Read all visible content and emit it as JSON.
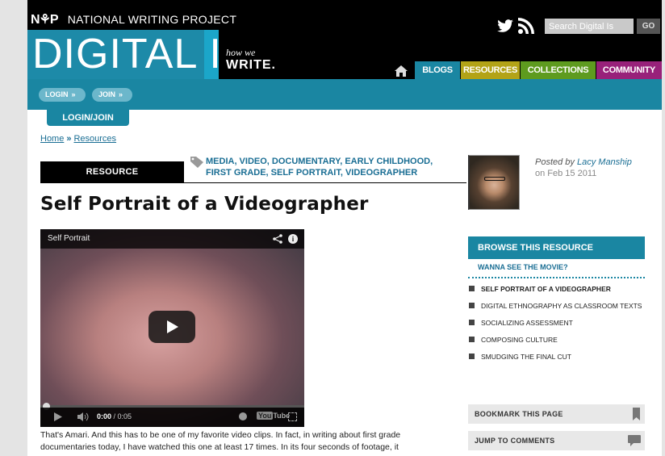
{
  "header": {
    "org_logo": "N⚘P",
    "org_name": "NATIONAL WRITING PROJECT",
    "brand_digital": "DIGITAL",
    "brand_is": "IS",
    "tagline_small": "how we",
    "tagline_big": "WRITE.",
    "search_placeholder": "Search Digital Is",
    "go_label": "GO",
    "nav": {
      "blogs": "BLOGS",
      "resources": "RESOURCES",
      "collections": "COLLECTIONS",
      "community": "COMMUNITY"
    },
    "colors": {
      "blogs": "#1a86a2",
      "resources": "#b3a317",
      "collections": "#5e9b1f",
      "community": "#98217a"
    }
  },
  "account": {
    "login_label": "LOGIN",
    "join_label": "JOIN",
    "arrow": "»",
    "tab_label": "LOGIN/JOIN"
  },
  "breadcrumb": {
    "home": "Home",
    "separator": "»",
    "current": "Resources"
  },
  "resource": {
    "type_label": "RESOURCE",
    "tags_line1": "MEDIA, VIDEO, DOCUMENTARY, EARLY CHILDHOOD,",
    "tags_line2": "FIRST GRADE, SELF PORTRAIT, VIDEOGRAPHER",
    "title": "Self Portrait of a Videographer"
  },
  "video": {
    "title": "Self Portrait",
    "time_current": "0:00",
    "time_total": "/ 0:05",
    "youtube_label": "You",
    "youtube_tube": "Tube"
  },
  "body": {
    "text": "That's Amari.  And this has to be one of my favorite video clips.  In fact, in writing about first grade documentaries today, I have watched this one at least 17 times.  In its four seconds of footage, it"
  },
  "author": {
    "posted_by": "Posted by",
    "name": "Lacy Manship",
    "date": "on Feb 15 2011"
  },
  "sidebar": {
    "browse_title": "BROWSE THIS RESOURCE",
    "wanna_link": "WANNA SEE THE MOVIE?",
    "items": [
      {
        "label": "SELF PORTRAIT OF A VIDEOGRAPHER"
      },
      {
        "label": "DIGITAL ETHNOGRAPHY AS CLASSROOM TEXTS"
      },
      {
        "label": "SOCIALIZING ASSESSMENT"
      },
      {
        "label": "COMPOSING CULTURE"
      },
      {
        "label": "SMUDGING THE FINAL CUT"
      }
    ],
    "bookmark_label": "BOOKMARK THIS PAGE",
    "comments_label": "JUMP TO COMMENTS"
  }
}
